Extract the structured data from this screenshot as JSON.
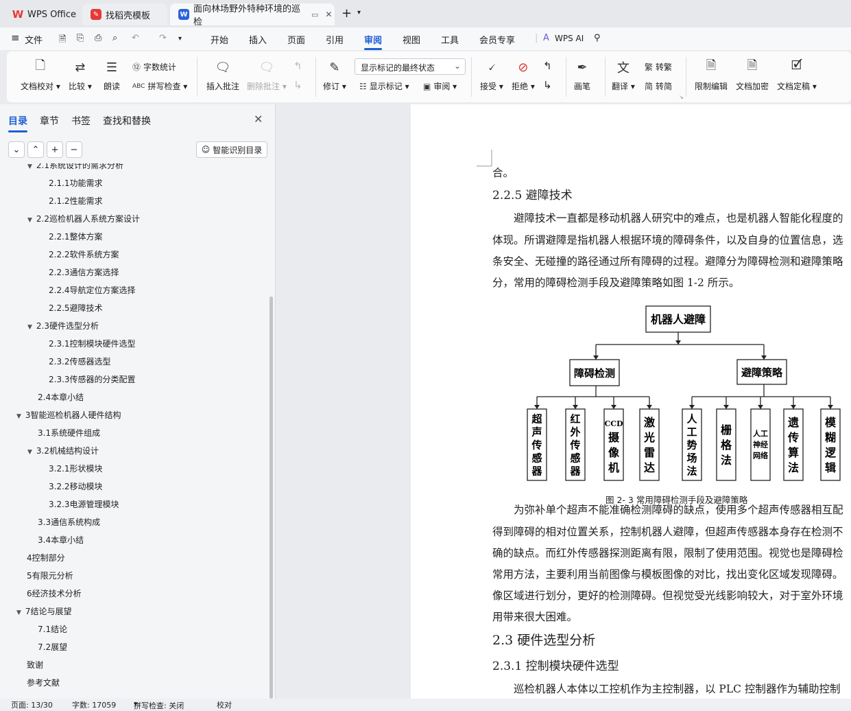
{
  "tabs": [
    {
      "label": "WPS Office",
      "icon": "wps-icon"
    },
    {
      "label": "找稻壳模板",
      "icon": "docer-icon"
    },
    {
      "label": "面向林场野外特种环境的巡检",
      "icon": "word-doc-icon"
    }
  ],
  "menu": {
    "file": "文件",
    "items": [
      "开始",
      "插入",
      "页面",
      "引用",
      "审阅",
      "视图",
      "工具",
      "会员专享"
    ],
    "active": "审阅",
    "ai": "WPS AI"
  },
  "ribbon": {
    "doc_check": "文档校对",
    "compare": "比较",
    "read_aloud": "朗读",
    "word_count": "字数统计",
    "spell_check": "拼写检查",
    "insert_comment": "插入批注",
    "delete_comment": "删除批注",
    "revise": "修订",
    "display_select": "显示标记的最终状态",
    "show_marks": "显示标记",
    "review": "审阅",
    "accept": "接受",
    "reject": "拒绝",
    "pen": "画笔",
    "translate": "翻译",
    "to_traditional": "转繁",
    "to_simplified": "转简",
    "restrict_edit": "限制编辑",
    "encrypt": "文档加密",
    "finalize": "文档定稿"
  },
  "panel": {
    "tabs": [
      "目录",
      "章节",
      "书签",
      "查找和替换"
    ],
    "active_tab": "目录",
    "smart_toc": "智能识别目录",
    "toc": [
      {
        "label": "2.1系统设计的需求分析",
        "level": 2,
        "expanded": true
      },
      {
        "label": "2.1.1功能需求",
        "level": 3
      },
      {
        "label": "2.1.2性能需求",
        "level": 3
      },
      {
        "label": "2.2巡检机器人系统方案设计",
        "level": 2,
        "expanded": true
      },
      {
        "label": "2.2.1整体方案",
        "level": 3
      },
      {
        "label": "2.2.2软件系统方案",
        "level": 3
      },
      {
        "label": "2.2.3通信方案选择",
        "level": 3
      },
      {
        "label": "2.2.4导航定位方案选择",
        "level": 3
      },
      {
        "label": "2.2.5避障技术",
        "level": 3
      },
      {
        "label": "2.3硬件选型分析",
        "level": 2,
        "expanded": true
      },
      {
        "label": "2.3.1控制模块硬件选型",
        "level": 3
      },
      {
        "label": "2.3.2传感器选型",
        "level": 3
      },
      {
        "label": "2.3.3传感器的分类配置",
        "level": 3
      },
      {
        "label": "2.4本章小结",
        "level": 2
      },
      {
        "label": "3智能巡检机器人硬件结构",
        "level": 1,
        "expanded": true
      },
      {
        "label": "3.1系统硬件组成",
        "level": 2
      },
      {
        "label": "3.2机械结构设计",
        "level": 2,
        "expanded": true
      },
      {
        "label": "3.2.1形状模块",
        "level": 3
      },
      {
        "label": "3.2.2移动模块",
        "level": 3
      },
      {
        "label": "3.2.3电源管理模块",
        "level": 3
      },
      {
        "label": "3.3通信系统构成",
        "level": 2
      },
      {
        "label": "3.4本章小结",
        "level": 2
      },
      {
        "label": "4控制部分",
        "level": 1
      },
      {
        "label": "5有限元分析",
        "level": 1
      },
      {
        "label": "6经济技术分析",
        "level": 1
      },
      {
        "label": "7结论与展望",
        "level": 1,
        "expanded": true
      },
      {
        "label": "7.1结论",
        "level": 2
      },
      {
        "label": "7.2展望",
        "level": 2
      },
      {
        "label": "致谢",
        "level": 1
      },
      {
        "label": "参考文献",
        "level": 1
      }
    ]
  },
  "doc": {
    "line0": "合。",
    "h225": "2.2.5  避障技术",
    "p1": [
      "　　避障技术一直都是移动机器人研究中的难点，也是机器人智能化程度的",
      "体现。所谓避障是指机器人根据环境的障碍条件，以及自身的位置信息，选",
      "条安全、无碰撞的路径通过所有障碍的过程。避障分为障碍检测和避障策略",
      "分，常用的障碍检测手段及避障策略如图 1-2 所示。"
    ],
    "diagram": {
      "root": "机器人避障",
      "branch_left": "障碍检测",
      "branch_right": "避障策略",
      "left_leaves": [
        "超声传感器",
        "红外传感器",
        "CCD摄像机",
        "激光雷达"
      ],
      "right_leaves": [
        "人工势场法",
        "栅格法",
        "人工神经网络",
        "遗传算法",
        "模糊逻辑"
      ]
    },
    "caption": "图 2- 3 常用障碍检测手段及避障策略",
    "p2": [
      "　　为弥补单个超声不能准确检测障碍的缺点，使用多个超声传感器相互配",
      "得到障碍的相对位置关系，控制机器人避障，但超声传感器本身存在检测不",
      "确的缺点。而红外传感器探测距离有限，限制了使用范围。视觉也是障碍检",
      "常用方法，主要利用当前图像与模板图像的对比，找出变化区域发现障碍。",
      "像区域进行划分，更好的检测障碍。但视觉受光线影响较大，对于室外环境",
      "用带来很大困难。"
    ],
    "h23": "2.3  硬件选型分析",
    "h231": "2.3.1  控制模块硬件选型",
    "p3": "　　巡检机器人本体以工控机作为主控制器，以 PLC 控制器作为辅助控制"
  },
  "status": {
    "page": "页面: 13/30",
    "words": "字数: 17059",
    "spell": "拼写检查: 关闭",
    "proof": "校对"
  }
}
